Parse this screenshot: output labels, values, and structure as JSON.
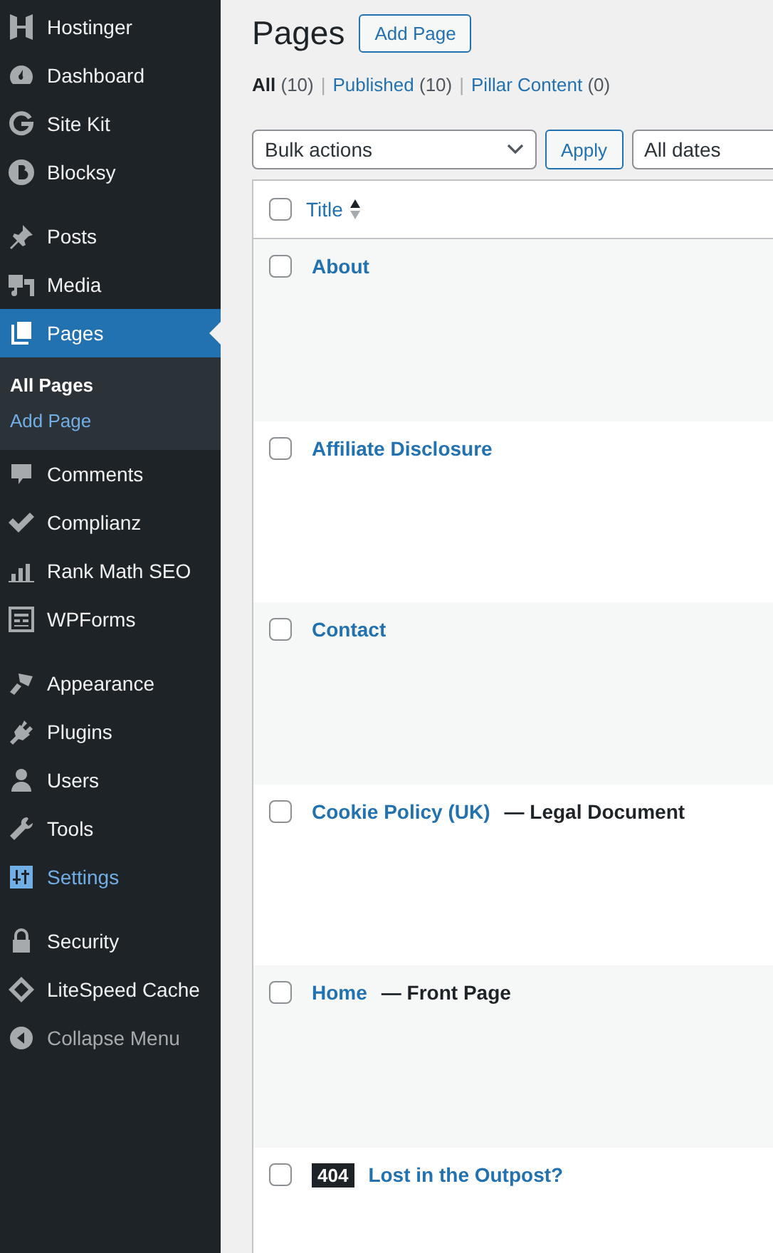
{
  "sidebar": {
    "groups": [
      {
        "items": [
          {
            "label": "Hostinger",
            "selected": false,
            "highlighted": false
          },
          {
            "label": "Dashboard",
            "selected": false,
            "highlighted": false
          },
          {
            "label": "Site Kit",
            "selected": false,
            "highlighted": false
          },
          {
            "label": "Blocksy",
            "selected": false,
            "highlighted": false
          }
        ]
      },
      {
        "items": [
          {
            "label": "Posts",
            "selected": false,
            "highlighted": false
          },
          {
            "label": "Media",
            "selected": false,
            "highlighted": false
          },
          {
            "label": "Pages",
            "selected": true,
            "highlighted": false,
            "submenu": [
              {
                "label": "All Pages",
                "selected": true
              },
              {
                "label": "Add Page",
                "selected": false
              }
            ]
          },
          {
            "label": "Comments",
            "selected": false,
            "highlighted": false
          },
          {
            "label": "Complianz",
            "selected": false,
            "highlighted": false
          },
          {
            "label": "Rank Math SEO",
            "selected": false,
            "highlighted": false
          },
          {
            "label": "WPForms",
            "selected": false,
            "highlighted": false
          }
        ]
      },
      {
        "items": [
          {
            "label": "Appearance",
            "selected": false,
            "highlighted": false
          },
          {
            "label": "Plugins",
            "selected": false,
            "highlighted": false
          },
          {
            "label": "Users",
            "selected": false,
            "highlighted": false
          },
          {
            "label": "Tools",
            "selected": false,
            "highlighted": false
          },
          {
            "label": "Settings",
            "selected": false,
            "highlighted": true
          }
        ]
      },
      {
        "items": [
          {
            "label": "Security",
            "selected": false,
            "highlighted": false
          },
          {
            "label": "LiteSpeed Cache",
            "selected": false,
            "highlighted": false
          },
          {
            "label": "Collapse Menu",
            "selected": false,
            "highlighted": false,
            "dim": true
          }
        ]
      }
    ]
  },
  "heading": "Pages",
  "add_button": "Add Page",
  "filters": [
    {
      "label": "All",
      "count": "(10)",
      "selected": true
    },
    {
      "label": "Published",
      "count": "(10)",
      "selected": false
    },
    {
      "label": "Pillar Content",
      "count": "(0)",
      "selected": false
    }
  ],
  "separator": "|",
  "bulk_actions": "Bulk actions",
  "apply_button": "Apply",
  "date_filter": "All dates",
  "table": {
    "select_all_checked": false,
    "columns": [
      "Title"
    ],
    "rows": [
      {
        "title": "About",
        "checked": false
      },
      {
        "title": "Affiliate Disclosure",
        "checked": false
      },
      {
        "title": "Contact",
        "checked": false
      },
      {
        "title": "Cookie Policy (UK)",
        "state": "— Legal Document",
        "checked": false
      },
      {
        "title": "Home",
        "state": "— Front Page",
        "checked": false
      },
      {
        "badge": "404",
        "title": "Lost in the Outpost?",
        "checked": false
      }
    ]
  }
}
